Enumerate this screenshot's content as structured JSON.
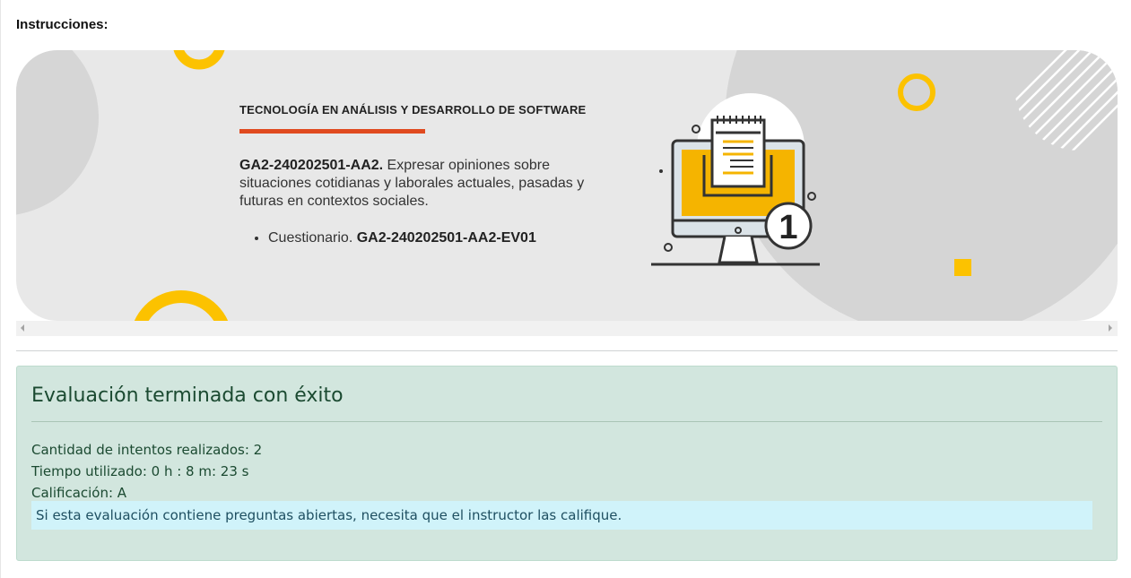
{
  "page": {
    "instructions_heading": "Instrucciones:"
  },
  "banner": {
    "program_title": "TECNOLOGÍA EN ANÁLISIS Y DESARROLLO DE SOFTWARE",
    "activity_code": "GA2-240202501-AA2.",
    "activity_description": " Expresar opiniones sobre situaciones cotidianas y laborales actuales, pasadas y futuras en contextos sociales.",
    "deliverable_prefix": "Cuestionario. ",
    "deliverable_code": "GA2-240202501-AA2-EV01",
    "illustration_icon": "computer-checklist-icon",
    "illustration_badge": "1",
    "colors": {
      "accent": "#e04a1f",
      "yellow": "#fcc200",
      "background": "#e8e8e8"
    }
  },
  "result": {
    "title": "Evaluación terminada con éxito",
    "attempts": "Cantidad de intentos realizados: 2",
    "time_used": "Tiempo utilizado: 0 h : 8 m: 23 s",
    "grade": "Calificación: A",
    "notice": "Si esta evaluación contiene preguntas abiertas, necesita que el instructor las califique.",
    "colors": {
      "panel": "#d2e6de",
      "text": "#1b4a31",
      "notice_bg": "#d0f3fa"
    }
  }
}
